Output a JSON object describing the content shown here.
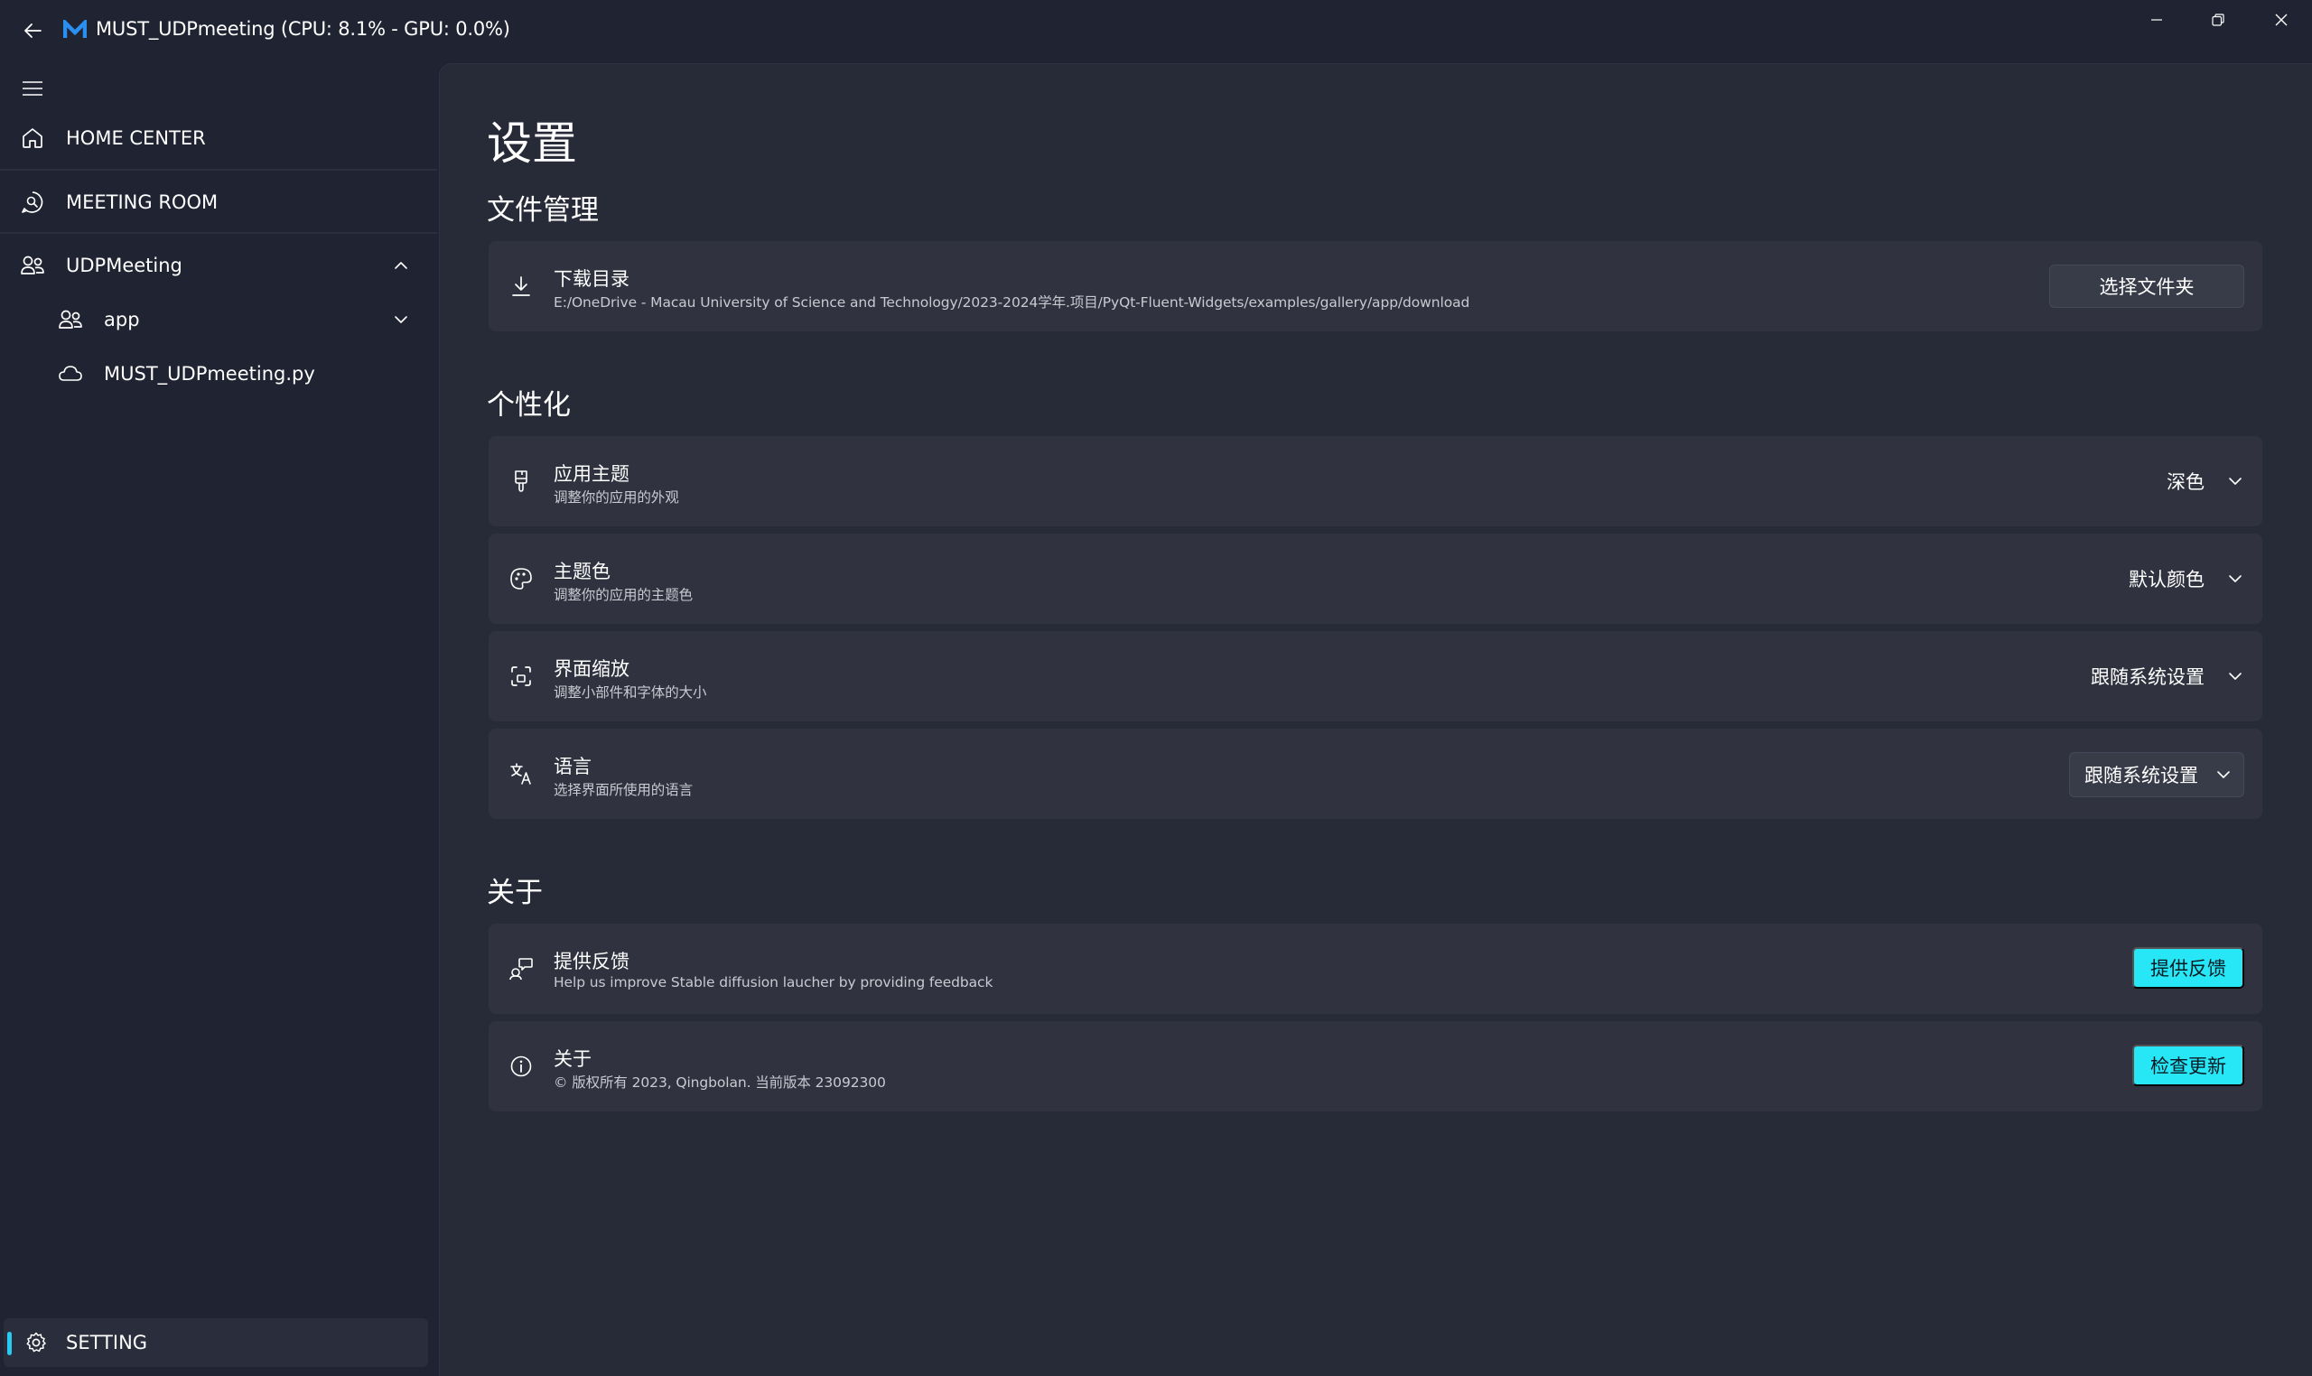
{
  "window": {
    "title": "MUST_UDPmeeting (CPU: 8.1% - GPU: 0.0%)"
  },
  "sidebar": {
    "items": [
      {
        "label": "HOME CENTER",
        "icon": "home-icon"
      },
      {
        "label": "MEETING ROOM",
        "icon": "chat-search-icon"
      },
      {
        "label": "UDPMeeting",
        "icon": "people-icon",
        "expanded": true
      },
      {
        "label": "app",
        "icon": "people-icon"
      },
      {
        "label": "MUST_UDPmeeting.py",
        "icon": "cloud-icon"
      }
    ],
    "setting": {
      "label": "SETTING",
      "icon": "gear-icon",
      "selected": true
    }
  },
  "page": {
    "title": "设置",
    "sections": [
      {
        "title": "文件管理",
        "cards": [
          {
            "title": "下载目录",
            "desc": "E:/OneDrive - Macau University of Science and Technology/2023-2024学年.项目/PyQt-Fluent-Widgets/examples/gallery/app/download",
            "action": "选择文件夹",
            "icon": "download-icon"
          }
        ]
      },
      {
        "title": "个性化",
        "cards": [
          {
            "title": "应用主题",
            "desc": "调整你的应用的外观",
            "value": "深色",
            "icon": "brush-icon"
          },
          {
            "title": "主题色",
            "desc": "调整你的应用的主题色",
            "value": "默认颜色",
            "icon": "palette-icon"
          },
          {
            "title": "界面缩放",
            "desc": "调整小部件和字体的大小",
            "value": "跟随系统设置",
            "icon": "zoom-fit-icon"
          },
          {
            "title": "语言",
            "desc": "选择界面所使用的语言",
            "value": "跟随系统设置",
            "icon": "translate-icon"
          }
        ]
      },
      {
        "title": "关于",
        "cards": [
          {
            "title": "提供反馈",
            "desc": "Help us improve Stable diffusion laucher by providing feedback",
            "action": "提供反馈",
            "icon": "feedback-icon"
          },
          {
            "title": "关于",
            "desc": "© 版权所有 2023, Qingbolan. 当前版本 23092300",
            "action": "检查更新",
            "icon": "info-icon"
          }
        ]
      }
    ]
  },
  "colors": {
    "accent": "#27e6f5",
    "indicator": "#29c9f0",
    "background": "#202331",
    "content": "#272a37",
    "card": "#30333f"
  }
}
